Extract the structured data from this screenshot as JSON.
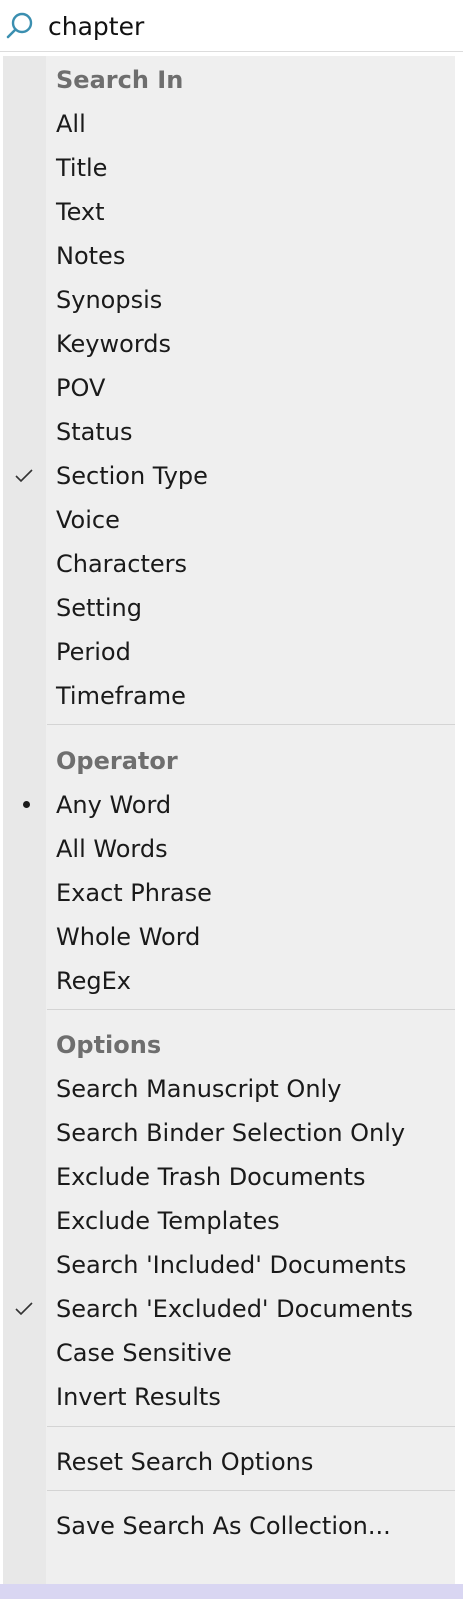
{
  "search": {
    "query": "chapter",
    "icon": "search-icon"
  },
  "menu": {
    "search_in": {
      "header": "Search In",
      "items": [
        {
          "label": "All",
          "checked": false
        },
        {
          "label": "Title",
          "checked": false
        },
        {
          "label": "Text",
          "checked": false
        },
        {
          "label": "Notes",
          "checked": false
        },
        {
          "label": "Synopsis",
          "checked": false
        },
        {
          "label": "Keywords",
          "checked": false
        },
        {
          "label": "POV",
          "checked": false
        },
        {
          "label": "Status",
          "checked": false
        },
        {
          "label": "Section Type",
          "checked": true
        },
        {
          "label": "Voice",
          "checked": false
        },
        {
          "label": "Characters",
          "checked": false
        },
        {
          "label": "Setting",
          "checked": false
        },
        {
          "label": "Period",
          "checked": false
        },
        {
          "label": "Timeframe",
          "checked": false
        }
      ]
    },
    "operator": {
      "header": "Operator",
      "items": [
        {
          "label": "Any Word",
          "selected": true
        },
        {
          "label": "All Words",
          "selected": false
        },
        {
          "label": "Exact Phrase",
          "selected": false
        },
        {
          "label": "Whole Word",
          "selected": false
        },
        {
          "label": "RegEx",
          "selected": false
        }
      ]
    },
    "options": {
      "header": "Options",
      "items": [
        {
          "label": "Search Manuscript Only",
          "checked": false
        },
        {
          "label": "Search Binder Selection Only",
          "checked": false
        },
        {
          "label": "Exclude Trash Documents",
          "checked": false
        },
        {
          "label": "Exclude Templates",
          "checked": false
        },
        {
          "label": "Search 'Included' Documents",
          "checked": false
        },
        {
          "label": "Search 'Excluded' Documents",
          "checked": true
        },
        {
          "label": "Case Sensitive",
          "checked": false
        },
        {
          "label": "Invert Results",
          "checked": false
        }
      ]
    },
    "reset_label": "Reset Search Options",
    "save_label": "Save Search As Collection..."
  },
  "colors": {
    "menu_bg": "#efefef",
    "gutter_bg": "#e8e8e8",
    "header_text": "#6e6e6e",
    "icon_accent": "#3b8fb0"
  }
}
